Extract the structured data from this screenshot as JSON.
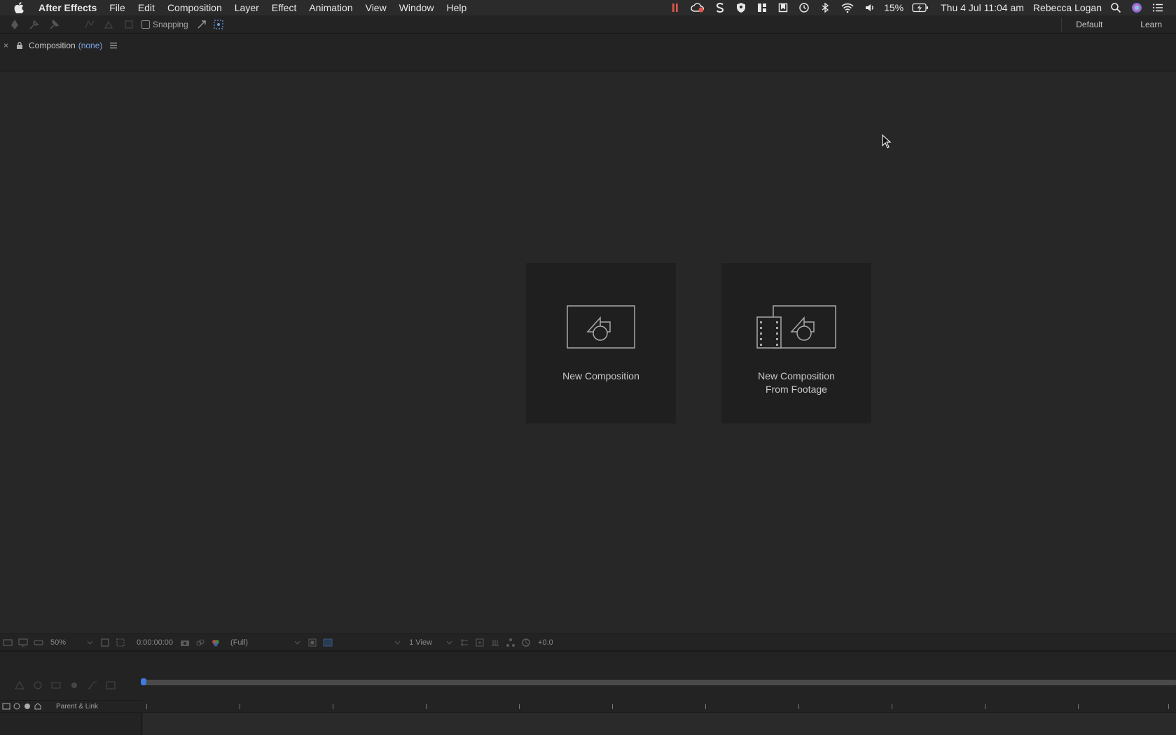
{
  "menubar": {
    "app_name": "After Effects",
    "items": [
      "File",
      "Edit",
      "Composition",
      "Layer",
      "Effect",
      "Animation",
      "View",
      "Window",
      "Help"
    ],
    "battery_percent": "15%",
    "datetime": "Thu 4 Jul  11:04 am",
    "user": "Rebecca Logan"
  },
  "toolbar": {
    "snapping_label": "Snapping",
    "workspaces": [
      "Default",
      "Learn"
    ]
  },
  "composition_panel": {
    "tab_label": "Composition",
    "tab_value": "(none)"
  },
  "viewer": {
    "cards": [
      {
        "label_line1": "New Composition",
        "label_line2": ""
      },
      {
        "label_line1": "New Composition",
        "label_line2": "From Footage"
      }
    ]
  },
  "viewer_footer": {
    "zoom": "50%",
    "timecode": "0:00:00:00",
    "resolution": "(Full)",
    "views": "1 View",
    "exposure": "+0.0"
  },
  "timeline": {
    "parent_link_label": "Parent & Link"
  },
  "colors": {
    "accent_blue": "#3d7be0",
    "link_blue": "#7da8e6",
    "recording_red": "#e0584a"
  }
}
